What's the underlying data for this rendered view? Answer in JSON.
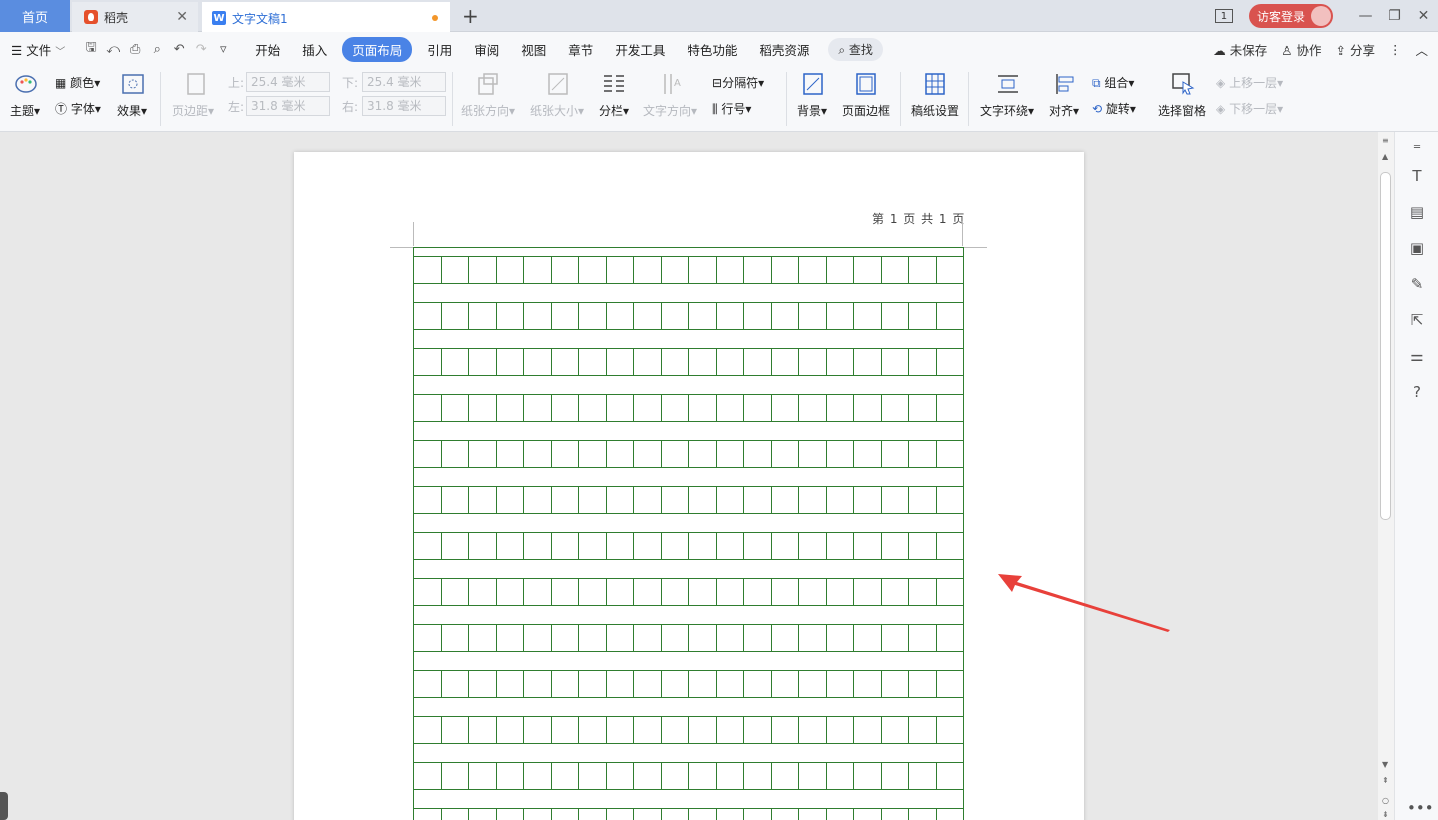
{
  "tabs": {
    "home": "首页",
    "daoke": "稻壳",
    "doc": "文字文稿1",
    "add": "+"
  },
  "window": {
    "page_badge": "1",
    "login": "访客登录",
    "minimize": "—",
    "restore": "❐",
    "close": "✕"
  },
  "menu": {
    "file": "文件",
    "items": [
      "开始",
      "插入",
      "页面布局",
      "引用",
      "审阅",
      "视图",
      "章节",
      "开发工具",
      "特色功能",
      "稻壳资源"
    ],
    "active": "页面布局",
    "search": "查找",
    "unsaved": "未保存",
    "collab": "协作",
    "share": "分享"
  },
  "ribbon": {
    "theme": "主题",
    "color": "颜色",
    "font": "字体",
    "effect": "效果",
    "margin": "页边距",
    "top_label": "上:",
    "top_value": "25.4 毫米",
    "bottom_label": "下:",
    "bottom_value": "25.4 毫米",
    "left_label": "左:",
    "left_value": "31.8 毫米",
    "right_label": "右:",
    "right_value": "31.8 毫米",
    "orientation": "纸张方向",
    "size": "纸张大小",
    "columns": "分栏",
    "text_direction": "文字方向",
    "separator": "分隔符",
    "line_number": "行号",
    "background": "背景",
    "page_border": "页面边框",
    "manuscript": "稿纸设置",
    "wrap": "文字环绕",
    "align": "对齐",
    "group": "组合",
    "rotate": "旋转",
    "selection_pane": "选择窗格",
    "bring_forward": "上移一层",
    "send_backward": "下移一层"
  },
  "document": {
    "header": "第 1 页 共 1 页",
    "grid_columns": 20,
    "grid_color": "#2f7d2f"
  },
  "colors": {
    "accent": "#4a83e6",
    "login": "#d9534f",
    "arrow": "#e8403a"
  }
}
